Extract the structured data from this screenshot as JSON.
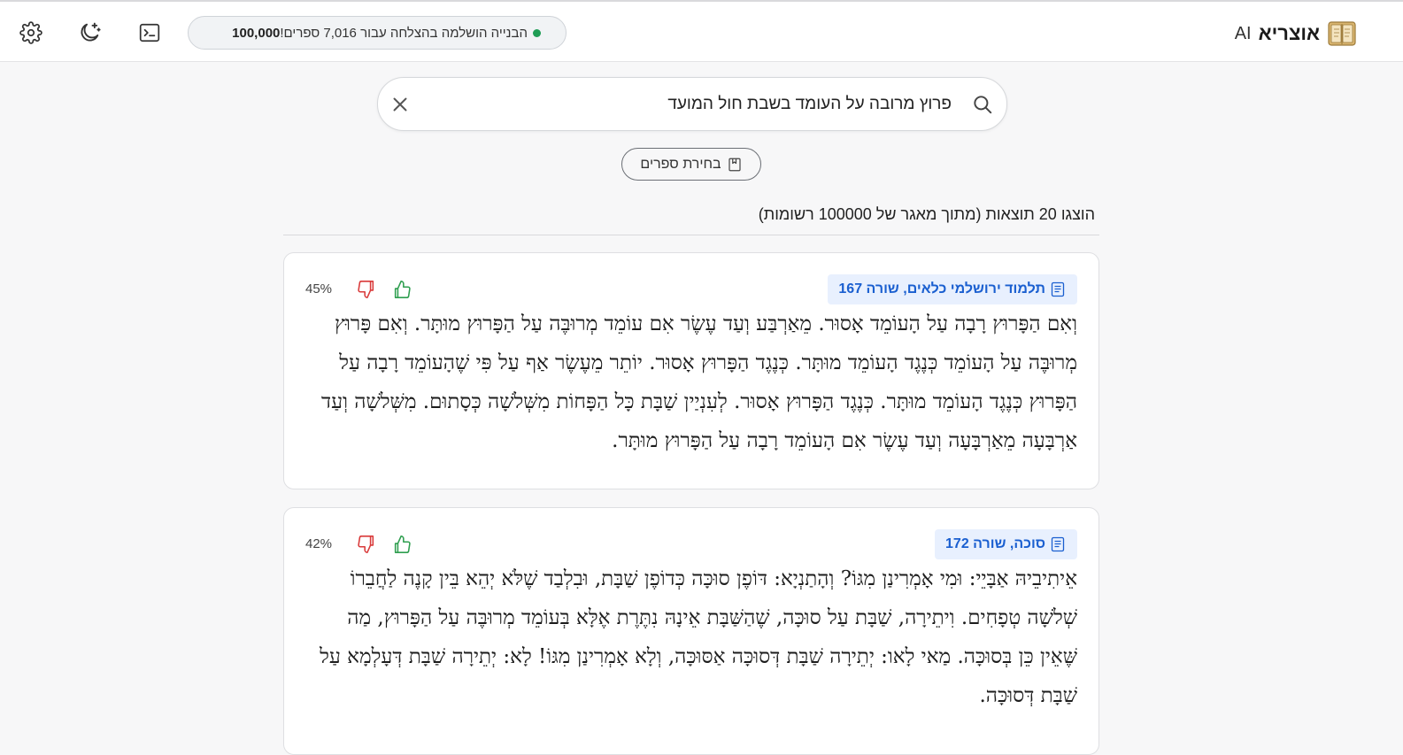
{
  "header": {
    "brand_title": "אוצריא",
    "brand_ai": "AI",
    "status_prefix": "הבנייה הושלמה בהצלחה עבור 7,016 ספרים!",
    "status_total": "100,000",
    "icons": [
      "gear-icon",
      "moon-stars-icon",
      "terminal-icon",
      "book-logo-icon"
    ]
  },
  "search": {
    "value": "פרוץ מרובה על העומד בשבת חול המועד",
    "placeholder": ""
  },
  "books_button": {
    "label": "בחירת ספרים"
  },
  "results": {
    "summary": "הוצגו 20 תוצאות (מתוך מאגר של 100000 רשומות)",
    "items": [
      {
        "source": "תלמוד ירושלמי כלאים, שורה 167",
        "score": "45%",
        "text": "וְאִם הַפָּרוּץ רָבָה עַל הָעוֹמֵד אָסוּר. מֵאַרְבַּע וְעַד עֶשֶׂר אִם עוֹמֵד מְרוּבֶּה עַל הַפָּרוּץ מוּתָּר. וְאִם פָּרוּץ מְרוּבֶּה עַל הָעוֹמֵד כְּנֶגֶד הָעוֹמֵד מוּתָּר. כְּנֶגֶד הַפָּרוּץ אָסוּר. יוֹתֵר מֵעֶשֶׂר אַף עַל פִּי שֶׁהָעוֹמֵד רָבָה עַל הַפָּרוּץ כְּנֶגֶד הָעוֹמֵד מוּתָּר. כְּנֶגֶד הַפָּרוּץ אָסוּר. לְעִנְיַין שַׁבָּת כָּל הַפָּחוֹת מִשְּׁלֹשָׁה כְּסָתוּם. מִשְּׁלֹשָׁה וְעַד אַרְבָּעָה מֵאַרְבָּעָה וְעַד עֶשֶׂר אִם הָעוֹמֵד רָבָה עַל הַפָּרוּץ מוּתָּר."
      },
      {
        "source": "סוכה, שורה 172",
        "score": "42%",
        "text": "אֵיתִיבֵיהּ אַבָּיֵי: וּמִי אָמְרִינַן מִגּוֹ? וְהָתַנְיָא: דּוֹפֶן סוּכָּה כְּדוֹפֶן שַׁבָּת, וּבִלְבַד שֶׁלֹּא יְהֵא בֵּין קָנֶה לַחֲבֵרוֹ שְׁלֹשָׁה טְפָחִים. וִיתֵירָה, שַׁבָּת עַל סוּכָּה, שֶׁהַשַּׁבָּת אֵינָהּ נִתֶּרֶת אֶלָּא בְּעוֹמֵד מְרוּבֶּה עַל הַפָּרוּץ, מַה שֶּׁאֵין כֵּן בְּסוּכָּה. מַאי לָאו: יְתֵירָה שַׁבָּת דְּסוּכָּה אַסּוּכָּה, וְלָא אָמְרִינַן מִגּוֹ! לָא: יְתֵירָה שַׁבָּת דְּעָלְמָא עַל שַׁבָּת דְּסוּכָּה."
      }
    ]
  },
  "colors": {
    "accent": "#1a5fd0",
    "chip_bg": "#e8f0fe",
    "like": "#2e9e4f",
    "dislike": "#d93a3a",
    "status_dot": "#1f9d55"
  }
}
